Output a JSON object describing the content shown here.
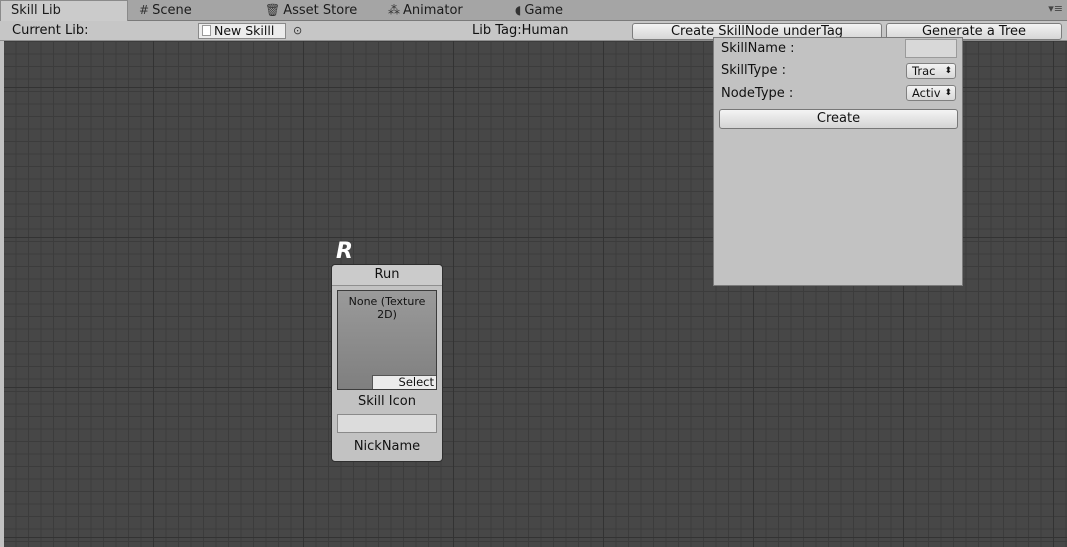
{
  "tabs": [
    {
      "label": "Skill Lib",
      "icon": ""
    },
    {
      "label": "Scene",
      "icon": "grid-icon"
    },
    {
      "label": "Asset Store",
      "icon": "bag-icon"
    },
    {
      "label": "Animator",
      "icon": "animator-icon"
    },
    {
      "label": "Game",
      "icon": "pacman-icon"
    }
  ],
  "toolbar": {
    "current_lib_label": "Current Lib:",
    "lib_field_value": "New Skilll",
    "lib_tag": "Lib Tag:Human",
    "create_btn": "Create SkillNode underTag",
    "generate_btn": "Generate a Tree"
  },
  "node": {
    "letter": "R",
    "title": "Run",
    "texture_text": "None (Texture 2D)",
    "select_label": "Select",
    "skill_icon_label": "Skill Icon",
    "nickname_value": "",
    "nickname_label": "NickName"
  },
  "popup": {
    "skill_name_label": "SkillName :",
    "skill_name_value": "",
    "skill_type_label": "SkillType :",
    "skill_type_value": "Trac",
    "node_type_label": "NodeType :",
    "node_type_value": "Activ",
    "create_label": "Create"
  },
  "colors": {
    "canvas_bg": "#474747",
    "panel_bg": "#c2c2c2",
    "tabbar_bg": "#a5a5a5"
  }
}
